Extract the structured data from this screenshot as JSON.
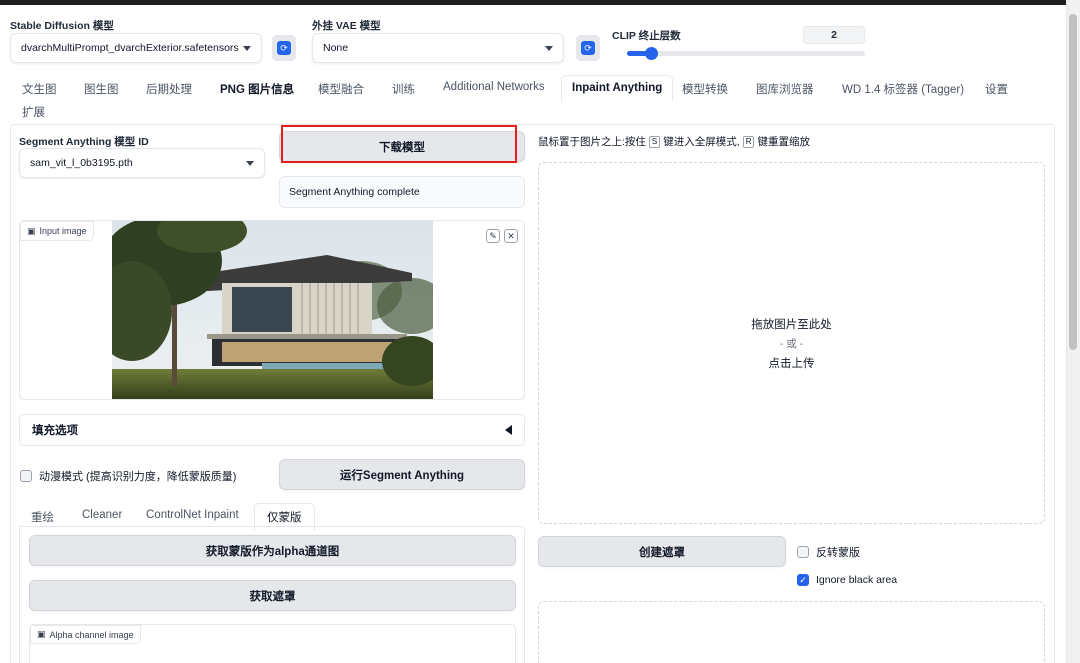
{
  "header": {
    "sd_model_label": "Stable Diffusion 模型",
    "sd_model_value": "dvarchMultiPrompt_dvarchExterior.safetensors",
    "vae_label": "外挂 VAE 模型",
    "vae_value": "None",
    "clip_label": "CLIP 终止层数",
    "clip_value": "2",
    "clip_slider_fraction": 0.1
  },
  "tabs": [
    {
      "label": "文生图"
    },
    {
      "label": "图生图"
    },
    {
      "label": "后期处理"
    },
    {
      "label": "PNG 图片信息"
    },
    {
      "label": "模型融合"
    },
    {
      "label": "训练"
    },
    {
      "label": "Additional Networks"
    },
    {
      "label": "Inpaint Anything"
    },
    {
      "label": "模型转换"
    },
    {
      "label": "图库浏览器"
    },
    {
      "label": "WD 1.4 标签器 (Tagger)"
    },
    {
      "label": "设置"
    },
    {
      "label": "扩展"
    }
  ],
  "left": {
    "sam_label": "Segment Anything 模型 ID",
    "sam_value": "sam_vit_l_0b3195.pth",
    "download_button": "下载模型",
    "status_text": "Segment Anything complete",
    "input_image_label": "Input image",
    "fill_options_label": "填充选项",
    "anime_mode_label": "动漫模式 (提高识别力度，降低蒙版质量)",
    "run_sam_button": "运行Segment Anything",
    "subtabs": [
      "重绘",
      "Cleaner",
      "ControlNet Inpaint",
      "仅蒙版"
    ],
    "get_alpha_button": "获取蒙版作为alpha通道图",
    "get_mask_button": "获取遮罩",
    "alpha_image_label": "Alpha channel image"
  },
  "right": {
    "hint_text": "鼠标置于图片之上:按住 S 键进入全屏模式, R 键重置缩放",
    "hint_parts": [
      "鼠标置于图片之上:按住",
      "S",
      "键进入全屏模式,",
      "R",
      "键重置缩放"
    ],
    "drop_line1": "拖放图片至此处",
    "drop_line2": "- 或 -",
    "drop_line3": "点击上传",
    "create_mask_button": "创建遮罩",
    "invert_mask_label": "反转蒙版",
    "ignore_black_label": "Ignore black area"
  },
  "colors": {
    "accent": "#2563eb",
    "highlight_box": "#e11d1d"
  }
}
